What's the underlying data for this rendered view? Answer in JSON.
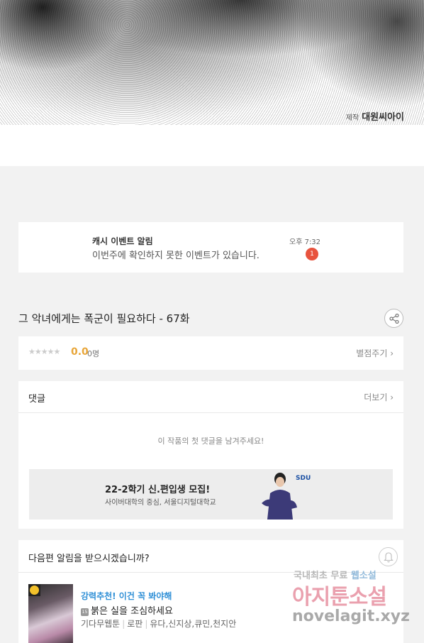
{
  "comic": {
    "credit_prefix": "제작",
    "credit_name": "대원씨아이"
  },
  "notification": {
    "title": "캐시 이벤트 알림",
    "message": "이번주에 확인하지 못한 이벤트가 있습니다.",
    "time": "오후 7:32",
    "badge_count": "1"
  },
  "episode": {
    "title": "그 악녀에게는 폭군이 필요하다 - 67화",
    "share_icon": "share-icon"
  },
  "rating": {
    "stars": "★★★★★",
    "score": "0.0",
    "count": "0명",
    "rate_label": "별점주기 ›"
  },
  "comments": {
    "label": "댓글",
    "more_label": "더보기 ›",
    "empty_text": "이 작품의 첫 댓글을 남겨주세요!"
  },
  "ad": {
    "headline": "22-2학기 신.편입생 모집!",
    "sub": "사이버대학의 중심, 서울디지털대학교",
    "logo": "SDU"
  },
  "alert": {
    "label": "다음편 알림을 받으시겠습니까?",
    "bell_icon": "bell-icon"
  },
  "recommend": {
    "tag": "강력추천! 이건 꼭 봐야해",
    "age": "15",
    "title": "붉은 실을 조심하세요",
    "meta": [
      "기다무웹툰",
      "로판",
      "유다,신지상,큐민,천지안"
    ]
  },
  "watermark": {
    "line1a": "국내최초 무료",
    "line1b": "웹소설",
    "line2": "아지툰소설",
    "line3": "novelagit.xyz"
  },
  "colors": {
    "accent_orange": "#e8a63a",
    "badge_red": "#e8533e",
    "link_blue": "#2f8fd6"
  }
}
